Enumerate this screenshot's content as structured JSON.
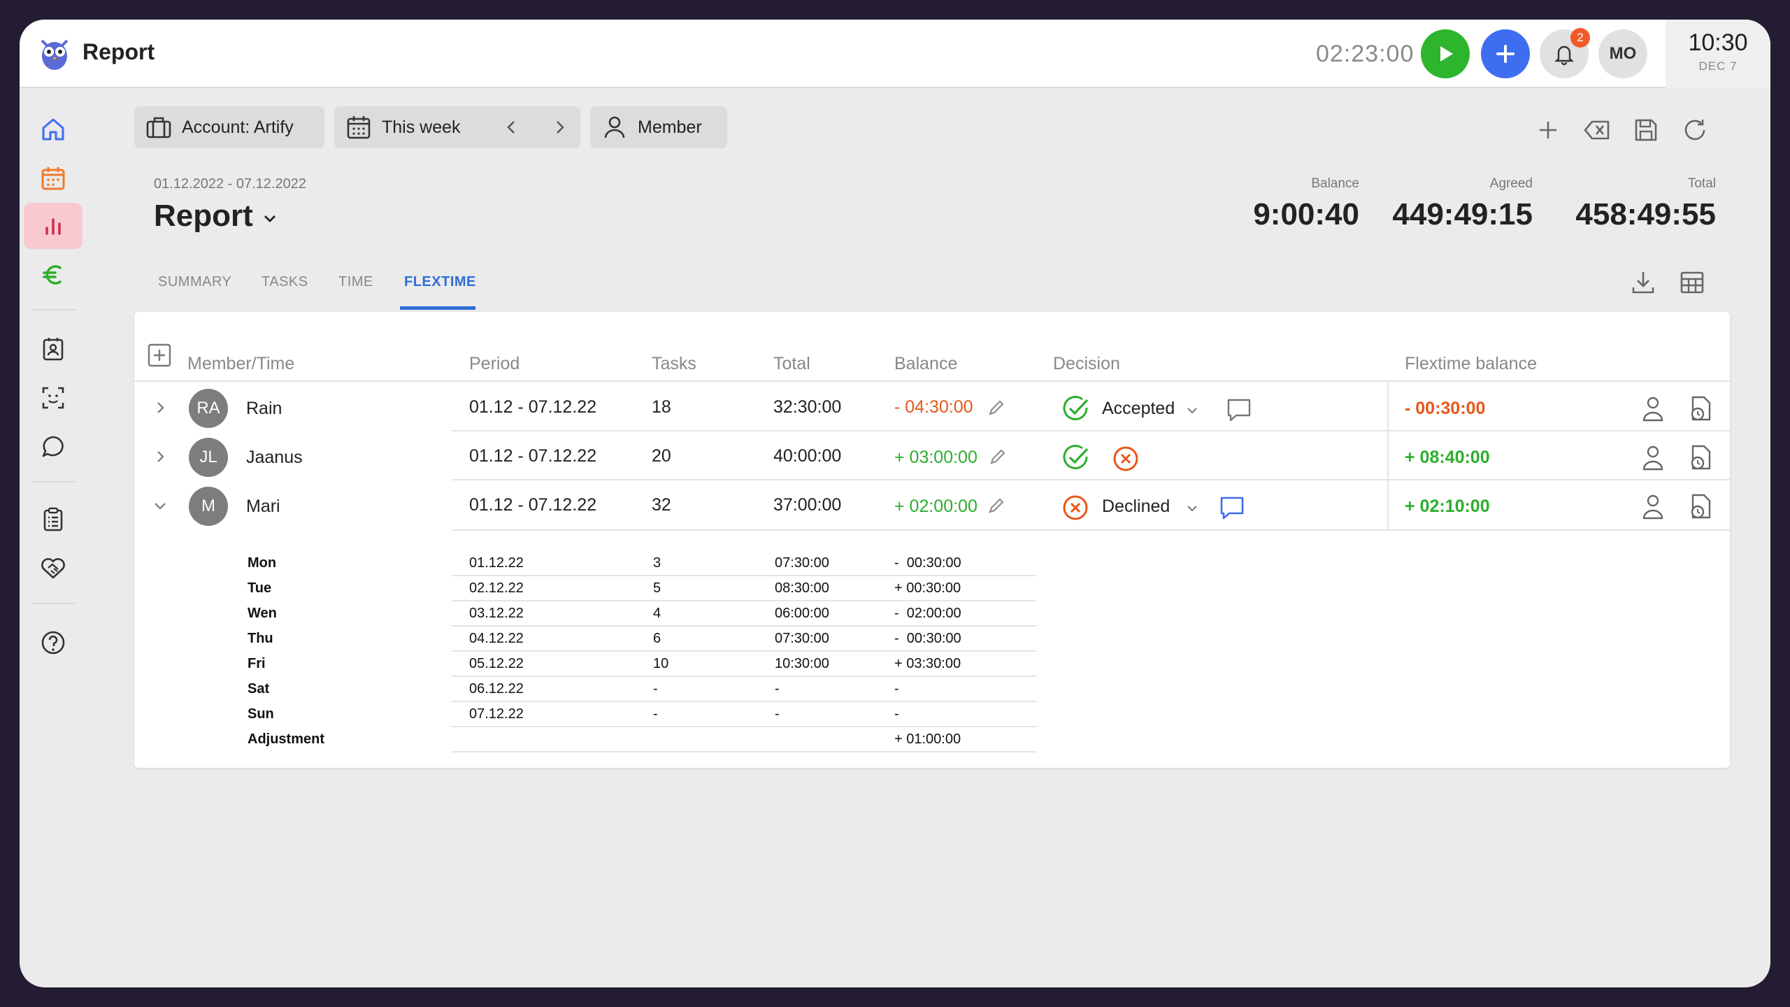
{
  "app": {
    "title": "Report"
  },
  "topbar": {
    "timer": "02:23:00",
    "notifications_count": "2",
    "user_initials": "MO",
    "clock_time": "10:30",
    "clock_date": "DEC 7"
  },
  "filters": {
    "account": "Account: Artify",
    "period": "This week",
    "member": "Member"
  },
  "report": {
    "date_range": "01.12.2022 - 07.12.2022",
    "title": "Report"
  },
  "stats": [
    {
      "label": "Balance",
      "value": "9:00:40"
    },
    {
      "label": "Agreed",
      "value": "449:49:15"
    },
    {
      "label": "Total",
      "value": "458:49:55"
    }
  ],
  "tabs": [
    "SUMMARY",
    "TASKS",
    "TIME",
    "FLEXTIME"
  ],
  "active_tab": "FLEXTIME",
  "table": {
    "columns": [
      "Member/Time",
      "Period",
      "Tasks",
      "Total",
      "Balance",
      "Decision",
      "Flextime balance"
    ],
    "rows": [
      {
        "initials": "RA",
        "name": "Rain",
        "period": "01.12 - 07.12.22",
        "tasks": "18",
        "total": "32:30:00",
        "balance": "- 04:30:00",
        "decision": "Accepted",
        "flextime": "- 00:30:00"
      },
      {
        "initials": "JL",
        "name": "Jaanus",
        "period": "01.12 - 07.12.22",
        "tasks": "20",
        "total": "40:00:00",
        "balance": "+ 03:00:00",
        "decision": "",
        "flextime": "+ 08:40:00"
      },
      {
        "initials": "M",
        "name": "Mari",
        "period": "01.12 - 07.12.22",
        "tasks": "32",
        "total": "37:00:00",
        "balance": "+ 02:00:00",
        "decision": "Declined",
        "flextime": "+ 02:10:00"
      }
    ],
    "mari_days": [
      {
        "day": "Mon",
        "date": "01.12.22",
        "tasks": "3",
        "total": "07:30:00",
        "balance": "-  00:30:00"
      },
      {
        "day": "Tue",
        "date": "02.12.22",
        "tasks": "5",
        "total": "08:30:00",
        "balance": "+ 00:30:00"
      },
      {
        "day": "Wen",
        "date": "03.12.22",
        "tasks": "4",
        "total": "06:00:00",
        "balance": "-  02:00:00"
      },
      {
        "day": "Thu",
        "date": "04.12.22",
        "tasks": "6",
        "total": "07:30:00",
        "balance": "-  00:30:00"
      },
      {
        "day": "Fri",
        "date": "05.12.22",
        "tasks": "10",
        "total": "10:30:00",
        "balance": "+ 03:30:00"
      },
      {
        "day": "Sat",
        "date": "06.12.22",
        "tasks": "-",
        "total": "-",
        "balance": "-"
      },
      {
        "day": "Sun",
        "date": "07.12.22",
        "tasks": "-",
        "total": "-",
        "balance": "-"
      },
      {
        "day": "Adjustment",
        "date": "",
        "tasks": "",
        "total": "",
        "balance": "+ 01:00:00"
      }
    ]
  },
  "colors": {
    "accent": "#2f6ed8",
    "positive": "#2cae2c",
    "negative": "#e8571a",
    "play": "#2db52d",
    "add": "#3f6df0",
    "sidebar_active": "#f8c9d1"
  },
  "icons": [
    "owl-logo",
    "play-icon",
    "plus-icon",
    "bell-icon",
    "home-icon",
    "calendar-icon",
    "chart-icon",
    "euro-icon",
    "contacts-icon",
    "face-scan-icon",
    "chat-icon",
    "clipboard-icon",
    "handshake-icon",
    "help-icon",
    "briefcase-icon",
    "person-icon",
    "add-icon",
    "clear-icon",
    "save-icon",
    "refresh-icon",
    "download-icon",
    "grid-icon",
    "chevron-icon",
    "check-circle-icon",
    "x-circle-icon",
    "comment-icon",
    "pencil-icon",
    "timesheet-icon"
  ]
}
